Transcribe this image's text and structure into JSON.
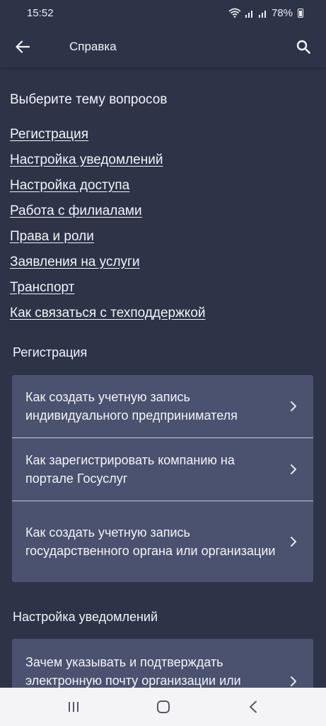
{
  "status": {
    "time": "15:52",
    "battery": "78%"
  },
  "header": {
    "title": "Справка"
  },
  "topics": {
    "title": "Выберите тему вопросов",
    "links": [
      "Регистрация",
      "Настройка уведомлений",
      "Настройка доступа",
      "Работа с филиалами",
      "Права и роли",
      "Заявления на услуги",
      "Транспорт",
      "Как связаться с техподдержкой"
    ]
  },
  "sections": [
    {
      "title": "Регистрация",
      "items": [
        "Как создать учетную запись индивидуального предпринимателя",
        "Как зарегистрировать компанию на портале Госуслуг",
        "Как создать учетную запись государственного органа или организации"
      ]
    },
    {
      "title": "Настройка уведомлений",
      "items": [
        "Зачем указывать и подтверждать электронную почту организации или"
      ]
    }
  ],
  "colors": {
    "background": "#2d3448",
    "card": "#4a526f",
    "divider": "#c4c8d4",
    "nav_bar": "#f4f4f6"
  },
  "icons": [
    "back-arrow-icon",
    "search-icon",
    "chevron-right-icon",
    "wifi-icon",
    "signal-icon",
    "battery-icon",
    "recent-apps-icon",
    "home-icon",
    "back-icon"
  ]
}
